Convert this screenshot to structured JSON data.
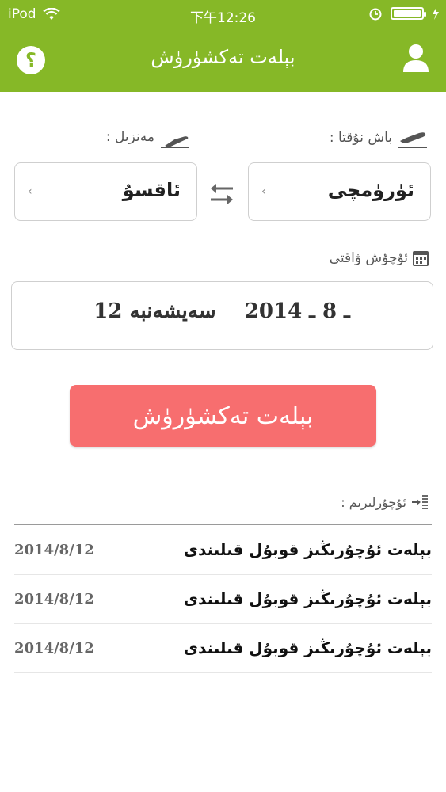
{
  "status_bar": {
    "carrier": "iPod",
    "time": "下午12:26"
  },
  "header": {
    "title": "بېلەت تەكشۈرۈش",
    "help_label": "؟"
  },
  "departure": {
    "label": "باش نۇقتا :",
    "value": "ئۈرۈمچى"
  },
  "arrival": {
    "label": "مەنزىل :",
    "value": "ئاقسۇ"
  },
  "date": {
    "label": "ئۇچۇش ۋاقتى",
    "value": "12 ـ 8 ـ 2014    سەيشەنبە"
  },
  "submit_label": "بېلەت تەكشۈرۈش",
  "history": {
    "label": "ئۇچۇرلىرىم :",
    "rows": [
      {
        "date": "2014/8/12",
        "text": "بېلەت ئۇچۇرىڭىز قوبۇل قىلىندى"
      },
      {
        "date": "2014/8/12",
        "text": "بېلەت ئۇچۇرىڭىز قوبۇل قىلىندى"
      },
      {
        "date": "2014/8/12",
        "text": "بېلەت ئۇچۇرىڭىز قوبۇل قىلىندى"
      }
    ]
  },
  "colors": {
    "header_green": "#86b827",
    "submit_red": "#f76e6f"
  },
  "icons": [
    "wifi-icon",
    "alarm-icon",
    "battery-icon",
    "charging-icon",
    "help-icon",
    "user-icon",
    "takeoff-icon",
    "landing-icon",
    "swap-icon",
    "calendar-icon",
    "history-icon",
    "chevron-left-icon"
  ]
}
